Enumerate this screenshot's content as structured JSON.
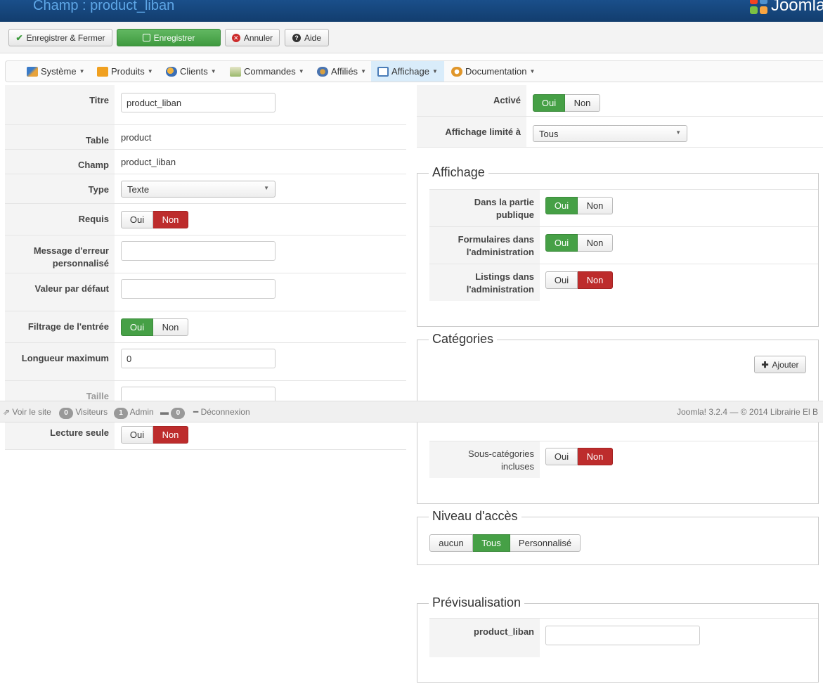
{
  "header": {
    "title": "Champ : product_liban",
    "logo_text": "Joomla!"
  },
  "toolbar": {
    "save_close": "Enregistrer & Fermer",
    "save": "Enregistrer",
    "cancel": "Annuler",
    "help": "Aide"
  },
  "menu": [
    {
      "label": "Système",
      "icon": "tools-icon"
    },
    {
      "label": "Produits",
      "icon": "products-icon"
    },
    {
      "label": "Clients",
      "icon": "clients-icon"
    },
    {
      "label": "Commandes",
      "icon": "orders-icon"
    },
    {
      "label": "Affiliés",
      "icon": "affiliates-icon"
    },
    {
      "label": "Affichage",
      "icon": "display-icon"
    },
    {
      "label": "Documentation",
      "icon": "documentation-icon"
    }
  ],
  "form": {
    "titre": {
      "label": "Titre",
      "value": "product_liban"
    },
    "table": {
      "label": "Table",
      "value": "product"
    },
    "champ": {
      "label": "Champ",
      "value": "product_liban"
    },
    "type": {
      "label": "Type",
      "value": "Texte"
    },
    "requis": {
      "label": "Requis"
    },
    "message": {
      "label1": "Message d'erreur",
      "label2": "personnalisé",
      "value": ""
    },
    "valeur": {
      "label": "Valeur par défaut",
      "value": ""
    },
    "filtrage": {
      "label": "Filtrage de l'entrée"
    },
    "longueur": {
      "label": "Longueur maximum",
      "value": "0"
    },
    "taille": {
      "label": "Taille"
    },
    "lecture": {
      "label": "Lecture seule"
    }
  },
  "toggle": {
    "oui": "Oui",
    "non": "Non"
  },
  "right": {
    "active": {
      "label": "Activé"
    },
    "limite": {
      "label": "Affichage limité à",
      "value": "Tous"
    },
    "affichage": {
      "legend": "Affichage",
      "publique": {
        "label1": "Dans la partie",
        "label2": "publique"
      },
      "formulaires": {
        "label1": "Formulaires dans",
        "label2": "l'administration"
      },
      "listings": {
        "label1": "Listings dans",
        "label2": "l'administration"
      }
    },
    "categories": {
      "legend": "Catégories",
      "add": "Ajouter",
      "sous": {
        "label1": "Sous-catégories",
        "label2": "incluses"
      }
    },
    "acces": {
      "legend": "Niveau d'accès",
      "aucun": "aucun",
      "tous": "Tous",
      "perso": "Personnalisé"
    },
    "preview": {
      "legend": "Prévisualisation",
      "label": "product_liban",
      "value": ""
    }
  },
  "status": {
    "view_site": "Voir le site",
    "visitors_count": "0",
    "visitors": "Visiteurs",
    "admin_count": "1",
    "admin": "Admin",
    "messages_count": "0",
    "logout": "Déconnexion",
    "version": "Joomla! 3.2.4",
    "copyright": "— © 2014 Librairie El B"
  },
  "colors": {
    "green": "#46a046",
    "red": "#bd2c2c",
    "header_blue": "#1a4f8a"
  }
}
